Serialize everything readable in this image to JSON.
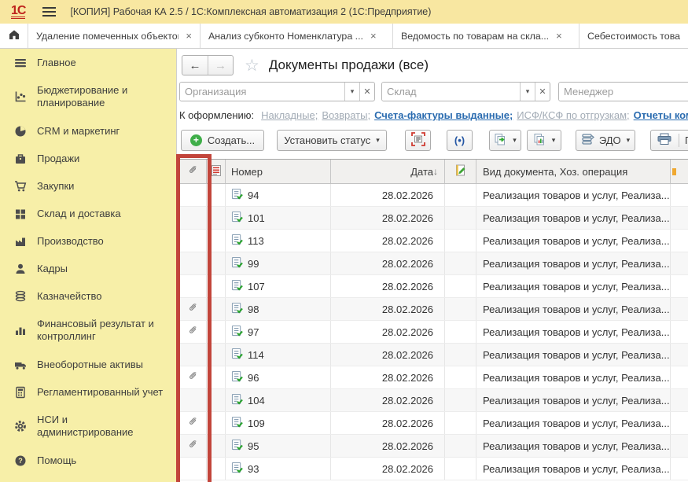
{
  "window": {
    "logo": "1С",
    "title": "[КОПИЯ] Рабочая КА 2.5 / 1С:Комплексная автоматизация 2  (1С:Предприятие)"
  },
  "tabs": [
    {
      "label": "Удаление помеченных объектов",
      "closable": true
    },
    {
      "label": "Анализ субконто Номенклатура ...",
      "closable": true
    },
    {
      "label": "Ведомость по товарам на скла...",
      "closable": true
    },
    {
      "label": "Себестоимость това...",
      "closable": false
    }
  ],
  "sidebar": {
    "items": [
      {
        "label": "Главное",
        "icon": "menu-icon"
      },
      {
        "label": "Бюджетирование и планирование",
        "icon": "planning-chart-icon"
      },
      {
        "label": "CRM и маркетинг",
        "icon": "pie-chart-icon"
      },
      {
        "label": "Продажи",
        "icon": "briefcase-icon"
      },
      {
        "label": "Закупки",
        "icon": "cart-icon"
      },
      {
        "label": "Склад и доставка",
        "icon": "grid-icon"
      },
      {
        "label": "Производство",
        "icon": "factory-icon"
      },
      {
        "label": "Кадры",
        "icon": "person-icon"
      },
      {
        "label": "Казначейство",
        "icon": "coins-icon"
      },
      {
        "label": "Финансовый результат и контроллинг",
        "icon": "bar-chart-icon"
      },
      {
        "label": "Внеоборотные активы",
        "icon": "truck-icon"
      },
      {
        "label": "Регламентированный учет",
        "icon": "calculator-icon"
      },
      {
        "label": "НСИ и администрирование",
        "icon": "gear-icon"
      },
      {
        "label": "Помощь",
        "icon": "help-icon"
      }
    ]
  },
  "main": {
    "title": "Документы продажи (все)",
    "icons": {
      "back": "←",
      "forward": "→",
      "star": "☆",
      "caret": "▾",
      "close": "×",
      "clear": "✕",
      "sort_desc": "↓",
      "signal": "(•)",
      "plus": "+"
    },
    "filters": [
      {
        "placeholder": "Организация"
      },
      {
        "placeholder": "Склад"
      },
      {
        "placeholder": "Менеджер"
      }
    ],
    "quick_links": {
      "label": "К оформлению:",
      "links": [
        {
          "text": "Накладные;",
          "emphasis": false
        },
        {
          "text": "Возвраты;",
          "emphasis": false
        },
        {
          "text": "Счета-фактуры выданные;",
          "emphasis": true
        },
        {
          "text": "ИСФ/КСФ по отгрузкам;",
          "emphasis": false
        },
        {
          "text": "Отчеты комисс",
          "emphasis": true
        }
      ]
    },
    "toolbar": {
      "create": "Создать...",
      "set_status": "Установить статус",
      "edo": "ЭДО",
      "print_partial": "П"
    },
    "table": {
      "columns": {
        "number": "Номер",
        "date": "Дата",
        "doc_type": "Вид документа, Хоз. операция"
      },
      "sort": {
        "column": "Дата",
        "direction": "desc"
      },
      "rows": [
        {
          "number": "94",
          "date": "28.02.2026",
          "doc_type": "Реализация товаров и услуг, Реализа...",
          "has_attachment": false
        },
        {
          "number": "101",
          "date": "28.02.2026",
          "doc_type": "Реализация товаров и услуг, Реализа...",
          "has_attachment": false
        },
        {
          "number": "113",
          "date": "28.02.2026",
          "doc_type": "Реализация товаров и услуг, Реализа...",
          "has_attachment": false
        },
        {
          "number": "99",
          "date": "28.02.2026",
          "doc_type": "Реализация товаров и услуг, Реализа...",
          "has_attachment": false
        },
        {
          "number": "107",
          "date": "28.02.2026",
          "doc_type": "Реализация товаров и услуг, Реализа...",
          "has_attachment": false
        },
        {
          "number": "98",
          "date": "28.02.2026",
          "doc_type": "Реализация товаров и услуг, Реализа...",
          "has_attachment": true
        },
        {
          "number": "97",
          "date": "28.02.2026",
          "doc_type": "Реализация товаров и услуг, Реализа...",
          "has_attachment": true
        },
        {
          "number": "114",
          "date": "28.02.2026",
          "doc_type": "Реализация товаров и услуг, Реализа...",
          "has_attachment": false
        },
        {
          "number": "96",
          "date": "28.02.2026",
          "doc_type": "Реализация товаров и услуг, Реализа...",
          "has_attachment": true
        },
        {
          "number": "104",
          "date": "28.02.2026",
          "doc_type": "Реализация товаров и услуг, Реализа...",
          "has_attachment": false
        },
        {
          "number": "109",
          "date": "28.02.2026",
          "doc_type": "Реализация товаров и услуг, Реализа...",
          "has_attachment": true
        },
        {
          "number": "95",
          "date": "28.02.2026",
          "doc_type": "Реализация товаров и услуг, Реализа...",
          "has_attachment": true
        },
        {
          "number": "93",
          "date": "28.02.2026",
          "doc_type": "Реализация товаров и услуг, Реализа...",
          "has_attachment": false
        }
      ]
    }
  },
  "annotation": {
    "target": "attachment-column",
    "color": "#c2453b"
  },
  "colors": {
    "titlebar": "#f8e7a1",
    "sidebar": "#f7efa8",
    "link_muted": "#a2abb5",
    "link_active": "#2b6cb0",
    "create_green": "#3fae49",
    "scan_red": "#cf3a30",
    "signal_blue": "#2456a4"
  }
}
